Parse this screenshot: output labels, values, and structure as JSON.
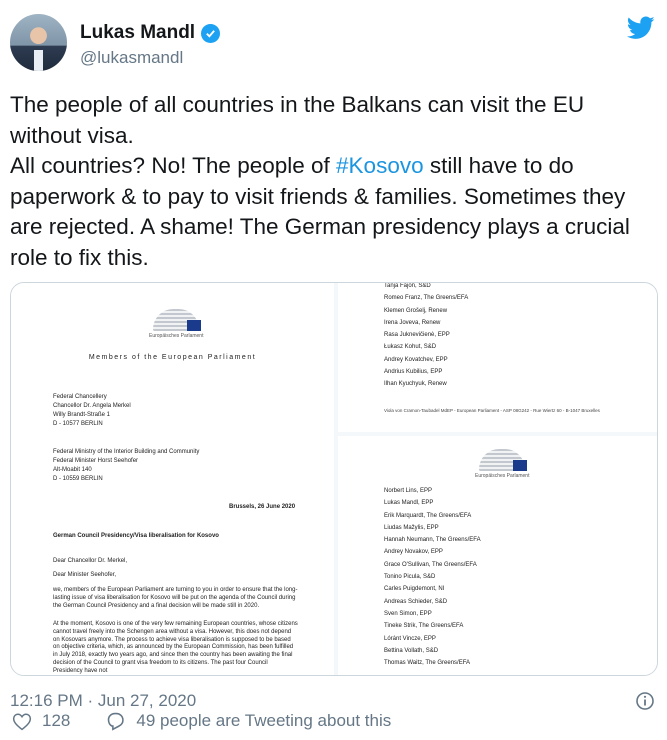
{
  "tweet": {
    "author_name": "Lukas Mandl",
    "author_handle": "@lukasmandl",
    "text_line1": "The people of all countries in the Balkans can visit the EU without visa.",
    "text_line2_pre": "All countries? No! The people of ",
    "hashtag": "#Kosovo",
    "text_line2_post": " still have to do paperwork & to pay to visit friends & families. Sometimes they are rejected. A shame! The German presidency plays a crucial role to fix this.",
    "timestamp": "12:16 PM · Jun 27, 2020",
    "like_count": "128",
    "reply_label": "49 people are Tweeting about this"
  },
  "colors": {
    "accent": "#1da1f2",
    "hashtag": "#1b95e0",
    "muted": "#657786",
    "text": "#14171a"
  },
  "icons": {
    "verified": "verified-badge-icon",
    "brand": "twitter-bird-icon",
    "info": "info-icon",
    "like": "heart-icon",
    "reply": "speech-bubble-icon"
  },
  "document_left": {
    "logo_caption": "Europäisches Parlament",
    "title": "Members of the European Parliament",
    "addr1": [
      "Federal Chancellery",
      "Chancellor Dr. Angela Merkel",
      "Willy Brandt-Straße 1",
      "D - 10577 BERLIN"
    ],
    "addr2": [
      "Federal Ministry of the Interior Building and Community",
      "Federal Minister Horst Seehofer",
      "Alt-Moabit 140",
      "D - 10559 BERLIN"
    ],
    "date": "Brussels, 26 June 2020",
    "subject": "German Council Presidency/Visa liberalisation for Kosovo",
    "salutation1": "Dear Chancellor Dr.  Merkel,",
    "salutation2": "Dear Minister Seehofer,",
    "para1": "we, members of the European Parliament are turning to you in order to ensure that the long-lasting issue of visa liberalisation for Kosovo will be put on the agenda of the Council during the German Council Presidency and a final decision will be made still in 2020.",
    "para2": "At the moment, Kosovo is one of the very few remaining European countries, whose citizens cannot travel freely into the Schengen area without a visa. However, this does not depend on Kosovars anymore. The process to achieve visa liberalisation is supposed to be based on objective criteria, which, as announced by the European Commission, has been fulfilled in July 2018, exactly two years ago, and since then the country has been awaiting the final decision of the Council to grant visa freedom to its citizens. The past four Council Presidency have not"
  },
  "document_right_top": {
    "signatories": [
      "Tanja Fajon, S&D",
      "Romeo Franz, The Greens/EFA",
      "Klemen Grošelj, Renew",
      "Irena Joveva, Renew",
      "Rasa Juknevičienė, EPP",
      "Łukasz Kohut, S&D",
      "Andrey Kovatchev, EPP",
      "Andrius Kubilius, EPP",
      "Ilhan Kyuchyuk, Renew"
    ],
    "footer": "Viola von Cramon-Taubadel MdEP - European Parliament - ASP 08G242 - Rue Wiertz 60 - B-1047 Bruxelles"
  },
  "document_right_bottom": {
    "logo_caption": "Europäisches Parlament",
    "signatories": [
      "Norbert Lins, EPP",
      "Lukas Mandl, EPP",
      "Erik Marquardt, The Greens/EFA",
      "Liudas Mažylis, EPP",
      "Hannah Neumann, The Greens/EFA",
      "Andrey Novakov, EPP",
      "Grace O'Sullivan, The Greens/EFA",
      "Tonino Picula, S&D",
      "Carles Puigdemont, NI",
      "Andreas Schieder, S&D",
      "Sven Simon, EPP",
      "Tineke Strik, The Greens/EFA",
      "Lóránt Vincze, EPP",
      "Bettina Vollath, S&D",
      "Thomas Waitz, The Greens/EFA"
    ]
  }
}
